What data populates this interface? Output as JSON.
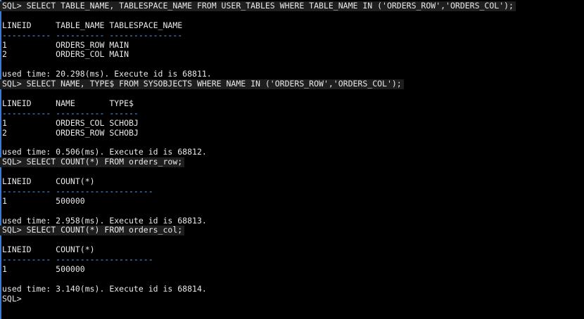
{
  "terminal": {
    "lines": [
      {
        "kind": "text",
        "text": "SQL> SELECT TABLE_NAME, TABLESPACE_NAME FROM USER_TABLES WHERE TABLE_NAME IN ('ORDERS_ROW','ORDERS_COL');",
        "highlight": true
      },
      {
        "kind": "blank"
      },
      {
        "kind": "text",
        "text": "LINEID     TABLE_NAME TABLESPACE_NAME"
      },
      {
        "kind": "sep",
        "text": "---------- ---------- ---------------"
      },
      {
        "kind": "text",
        "text": "1          ORDERS_ROW MAIN"
      },
      {
        "kind": "text",
        "text": "2          ORDERS_COL MAIN"
      },
      {
        "kind": "blank"
      },
      {
        "kind": "text",
        "text": "used time: 20.298(ms). Execute id is 68811."
      },
      {
        "kind": "text",
        "text": "SQL> SELECT NAME, TYPE$ FROM SYSOBJECTS WHERE NAME IN ('ORDERS_ROW','ORDERS_COL');",
        "highlight": true
      },
      {
        "kind": "blank"
      },
      {
        "kind": "text",
        "text": "LINEID     NAME       TYPE$"
      },
      {
        "kind": "sep",
        "text": "---------- ---------- ------"
      },
      {
        "kind": "text",
        "text": "1          ORDERS_COL SCHOBJ"
      },
      {
        "kind": "text",
        "text": "2          ORDERS_ROW SCHOBJ"
      },
      {
        "kind": "blank"
      },
      {
        "kind": "text",
        "text": "used time: 0.506(ms). Execute id is 68812."
      },
      {
        "kind": "text",
        "text": "SQL> SELECT COUNT(*) FROM orders_row;",
        "highlight": true
      },
      {
        "kind": "blank"
      },
      {
        "kind": "text",
        "text": "LINEID     COUNT(*)"
      },
      {
        "kind": "sep",
        "text": "---------- --------------------"
      },
      {
        "kind": "text",
        "text": "1          500000"
      },
      {
        "kind": "blank"
      },
      {
        "kind": "text",
        "text": "used time: 2.958(ms). Execute id is 68813."
      },
      {
        "kind": "text",
        "text": "SQL> SELECT COUNT(*) FROM orders_col;",
        "highlight": true
      },
      {
        "kind": "blank"
      },
      {
        "kind": "text",
        "text": "LINEID     COUNT(*)"
      },
      {
        "kind": "sep",
        "text": "---------- --------------------"
      },
      {
        "kind": "text",
        "text": "1          500000"
      },
      {
        "kind": "blank"
      },
      {
        "kind": "text",
        "text": "used time: 3.140(ms). Execute id is 68814."
      },
      {
        "kind": "text",
        "text": "SQL>"
      }
    ]
  },
  "colors": {
    "background": "#000000",
    "foreground": "#e8e8e8",
    "separator": "#5fa8ff",
    "cursor_bar": "#3c78d8"
  }
}
